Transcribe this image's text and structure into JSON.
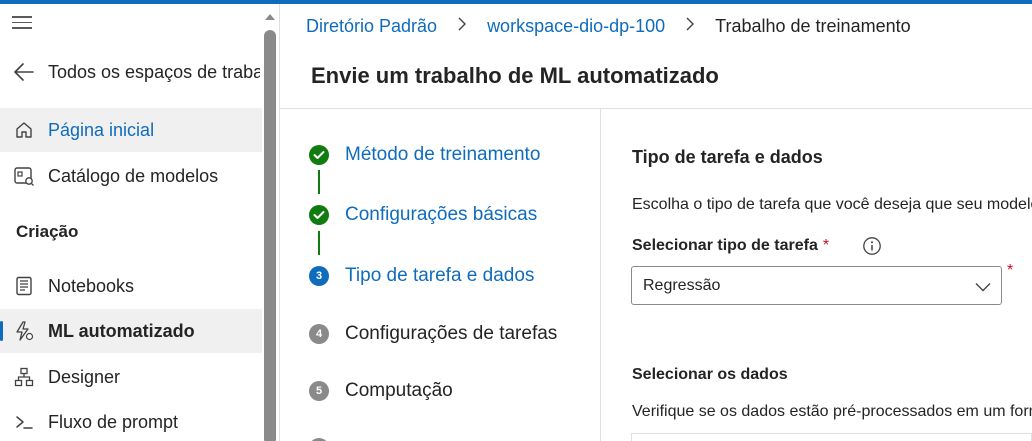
{
  "sidebar": {
    "back_label": "Todos os espaços de trabalho",
    "items": [
      {
        "label": "Página inicial",
        "icon": "home-icon"
      },
      {
        "label": "Catálogo de modelos",
        "icon": "model-catalog-icon"
      }
    ],
    "section_heading": "Criação",
    "authoring_items": [
      {
        "label": "Notebooks",
        "icon": "notebook-icon"
      },
      {
        "label": "ML automatizado",
        "icon": "automated-ml-icon"
      },
      {
        "label": "Designer",
        "icon": "designer-icon"
      },
      {
        "label": "Fluxo de prompt",
        "icon": "prompt-flow-icon"
      }
    ]
  },
  "breadcrumb": {
    "items": [
      "Diretório Padrão",
      "workspace-dio-dp-100"
    ],
    "current": "Trabalho de treinamento"
  },
  "page": {
    "title": "Envie um trabalho de ML automatizado"
  },
  "stepper": {
    "steps": [
      {
        "label": "Método de treinamento",
        "state": "done"
      },
      {
        "label": "Configurações básicas",
        "state": "done"
      },
      {
        "label": "Tipo de tarefa e dados",
        "state": "current",
        "number": "3"
      },
      {
        "label": "Configurações de tarefas",
        "state": "todo",
        "number": "4"
      },
      {
        "label": "Computação",
        "state": "todo",
        "number": "5"
      }
    ]
  },
  "form": {
    "section_title": "Tipo de tarefa e dados",
    "description": "Escolha o tipo de tarefa que você deseja que seu modelo",
    "task_type_label": "Selecionar tipo de tarefa",
    "required_mark": "*",
    "task_type_value": "Regressão",
    "data_title": "Selecionar os dados",
    "data_description": "Verifique se os dados estão pré-processados em um formato"
  },
  "colors": {
    "accent": "#0f6cbd",
    "success": "#107c10",
    "required": "#c50f1f"
  }
}
